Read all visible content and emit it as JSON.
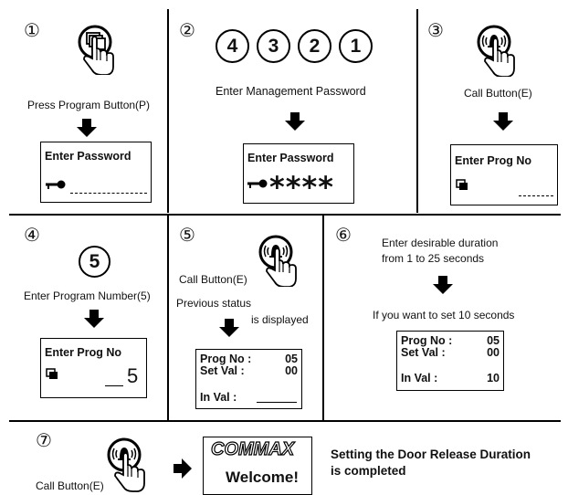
{
  "steps": {
    "s1": {
      "num": "①",
      "caption": "Press Program Button(P)",
      "lcd_title": "Enter Password"
    },
    "s2": {
      "num": "②",
      "pin": [
        "4",
        "3",
        "2",
        "1"
      ],
      "caption": "Enter Management Password",
      "lcd_title": "Enter Password",
      "stars": "****"
    },
    "s3": {
      "num": "③",
      "caption": "Call Button(E)",
      "lcd_title": "Enter Prog  No"
    },
    "s4": {
      "num": "④",
      "big_digit": "5",
      "caption": "Enter Program Number(5)",
      "lcd_title": "Enter Prog  No",
      "lcd_value": "5"
    },
    "s5": {
      "num": "⑤",
      "caption1": "Call Button(E)",
      "caption2a": "Previous status",
      "caption2b": "is displayed",
      "lcd": {
        "prog_label": "Prog No :",
        "prog_value": "05",
        "set_label": "Set  Val :",
        "set_value": "00",
        "in_label": "In Val :"
      }
    },
    "s6": {
      "num": "⑥",
      "caption1a": "Enter desirable duration",
      "caption1b": "from 1 to 25 seconds",
      "caption2": "If you want to set 10 seconds",
      "lcd": {
        "prog_label": "Prog No :",
        "prog_value": "05",
        "set_label": "Set  Val :",
        "set_value": "00",
        "in_label": "In Val :",
        "in_value": "10"
      }
    },
    "s7": {
      "num": "⑦",
      "caption": "Call Button(E)",
      "brand": "COMMAX",
      "welcome": "Welcome!",
      "result_line1": "Setting the Door Release Duration",
      "result_line2": "is completed"
    }
  },
  "icons": {
    "program_button": "program-button-icon",
    "call_button": "call-button-icon",
    "key": "key-icon",
    "arrow": "arrow-down-icon"
  }
}
